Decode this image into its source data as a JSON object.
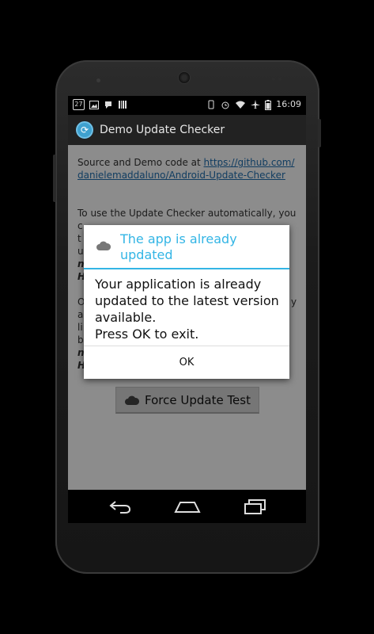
{
  "status_bar": {
    "notification_icons": [
      "calendar-icon",
      "image-icon",
      "chat-icon",
      "barcode-icon"
    ],
    "calendar_day": "27",
    "system_icons": [
      "vibrate-icon",
      "alarm-icon",
      "wifi-icon",
      "airplane-icon",
      "battery-icon"
    ],
    "time": "16:09"
  },
  "action_bar": {
    "title": "Demo Update Checker",
    "icon": "update-checker-app-icon"
  },
  "content": {
    "source_prefix": "Source and Demo code at ",
    "source_link": "https://github.com/danielemaddaluno/Android-Update-Checker",
    "para_auto_line1": "To use the Update Checker automatically, you",
    "para_auto_line2": "c",
    "para_auto_line3": "t",
    "para_auto_line4": "u",
    "para_auto_bold1": "n",
    "para_auto_bold2": "H",
    "para_force_line1": "O",
    "para_force_line2": "a",
    "para_force_line3": "li",
    "para_force_line4": "b",
    "para_force_bold1": "n",
    "para_force_bold2": "H",
    "para_force_right": "y",
    "force_button_label": "Force Update Test"
  },
  "dialog": {
    "title": "The app is already updated",
    "message_line1": "Your application is already",
    "message_line2": "updated to the latest version",
    "message_line3": "available.",
    "message_line4": "Press OK to exit.",
    "ok_label": "OK"
  },
  "nav_bar": {
    "items": [
      "back-icon",
      "home-icon",
      "recents-icon"
    ]
  },
  "colors": {
    "accent": "#33b5e5",
    "link": "#1f6fb1",
    "action_bar": "#222222"
  }
}
